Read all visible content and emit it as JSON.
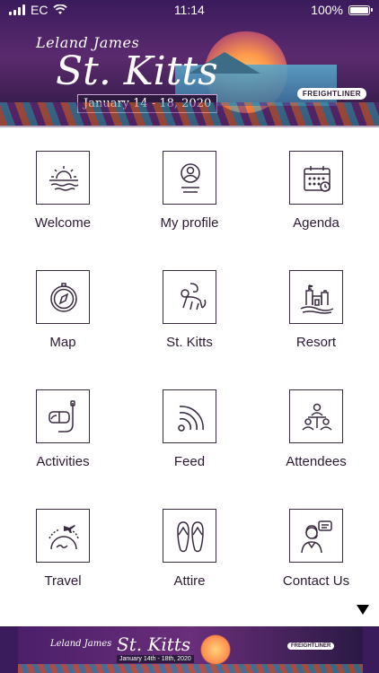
{
  "status_bar": {
    "carrier": "EC",
    "time": "11:14",
    "battery": "100%",
    "battery_level": 1.0
  },
  "header_banner": {
    "brand": "Leland James",
    "place": "St. Kitts",
    "dates": "January 14 - 18, 2020",
    "sponsor_logo": "FREIGHTLINER"
  },
  "menu": {
    "items": [
      {
        "label": "Welcome",
        "icon": "sunset-icon"
      },
      {
        "label": "My profile",
        "icon": "profile-icon"
      },
      {
        "label": "Agenda",
        "icon": "calendar-icon"
      },
      {
        "label": "Map",
        "icon": "compass-icon"
      },
      {
        "label": "St. Kitts",
        "icon": "monkey-icon"
      },
      {
        "label": "Resort",
        "icon": "sandcastle-icon"
      },
      {
        "label": "Activities",
        "icon": "snorkel-icon"
      },
      {
        "label": "Feed",
        "icon": "rss-feed-icon"
      },
      {
        "label": "Attendees",
        "icon": "attendees-icon"
      },
      {
        "label": "Travel",
        "icon": "airplane-globe-icon"
      },
      {
        "label": "Attire",
        "icon": "flip-flops-icon"
      },
      {
        "label": "Contact Us",
        "icon": "support-agent-icon"
      }
    ]
  },
  "scroll_indicator": {
    "icon": "triangle-down-icon"
  },
  "footer_banner": {
    "brand": "Leland James",
    "place": "St. Kitts",
    "dates": "January 14th - 18th, 2020",
    "sponsor_logo": "FREIGHTLINER"
  },
  "colors": {
    "banner_purple": "#3a1b5c",
    "icon_stroke": "#3a2c40",
    "text": "#2c1a33"
  }
}
